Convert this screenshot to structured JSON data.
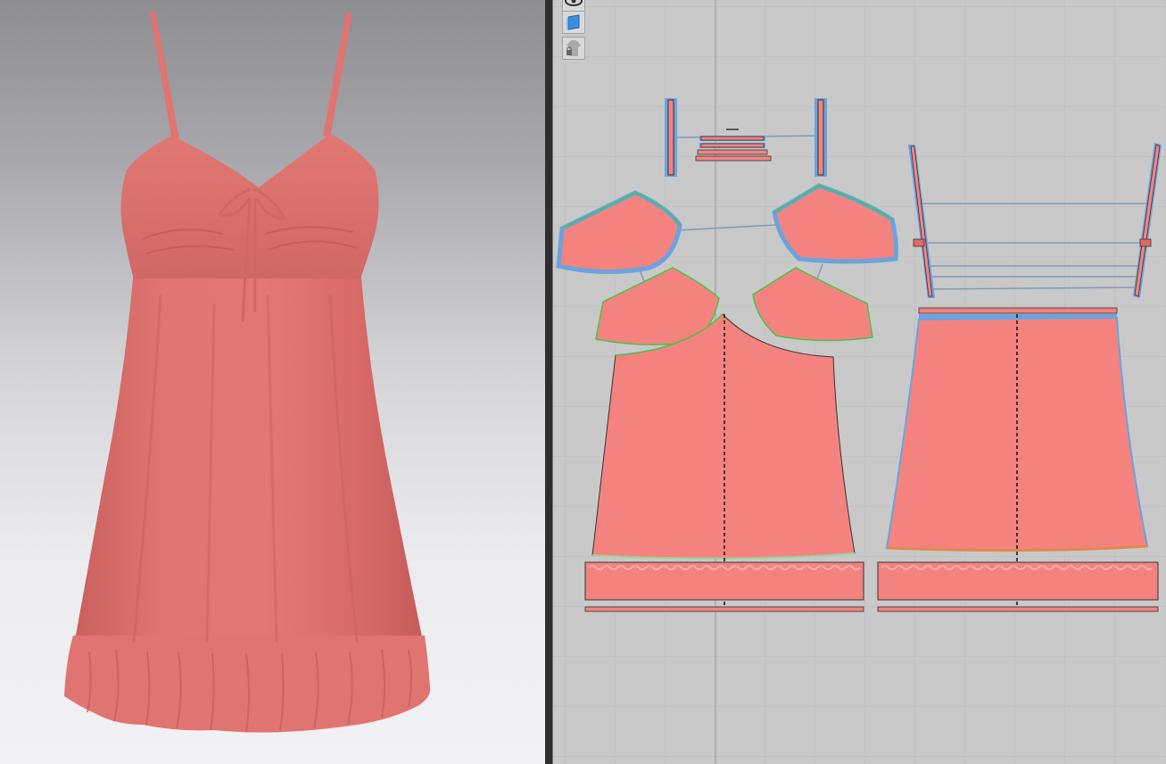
{
  "viewport_3d": {
    "background_top": "#8d8d92",
    "background_bottom": "#f2f2f6",
    "garment_color": "#e07470",
    "garment_shadow": "#c35c59",
    "garment_highlight": "#ea8985"
  },
  "view_2d": {
    "background": "#c9c9c9",
    "grid_color": "#bdbdbd",
    "axis_color": "#9a9a9a",
    "pattern_fill": "#f48380",
    "selected_outline_color": "#6aa3de",
    "sewing_line_color": "#4ac24a",
    "toolbar": {
      "tools": [
        {
          "name": "show-avatar-tool",
          "icon": "eye-icon"
        },
        {
          "name": "show-fabric-tool",
          "icon": "fabric-layer-icon"
        },
        {
          "name": "lock-tool",
          "icon": "locked-shirt-icon"
        }
      ]
    },
    "pattern_pieces": [
      "strap-left",
      "strap-right",
      "tie-ribbons",
      "cup-upper-left",
      "cup-upper-right",
      "cup-lower-left",
      "cup-lower-right",
      "front-body",
      "back-body",
      "back-straps",
      "front-ruffle",
      "back-ruffle",
      "front-hem-band",
      "back-hem-band"
    ]
  }
}
